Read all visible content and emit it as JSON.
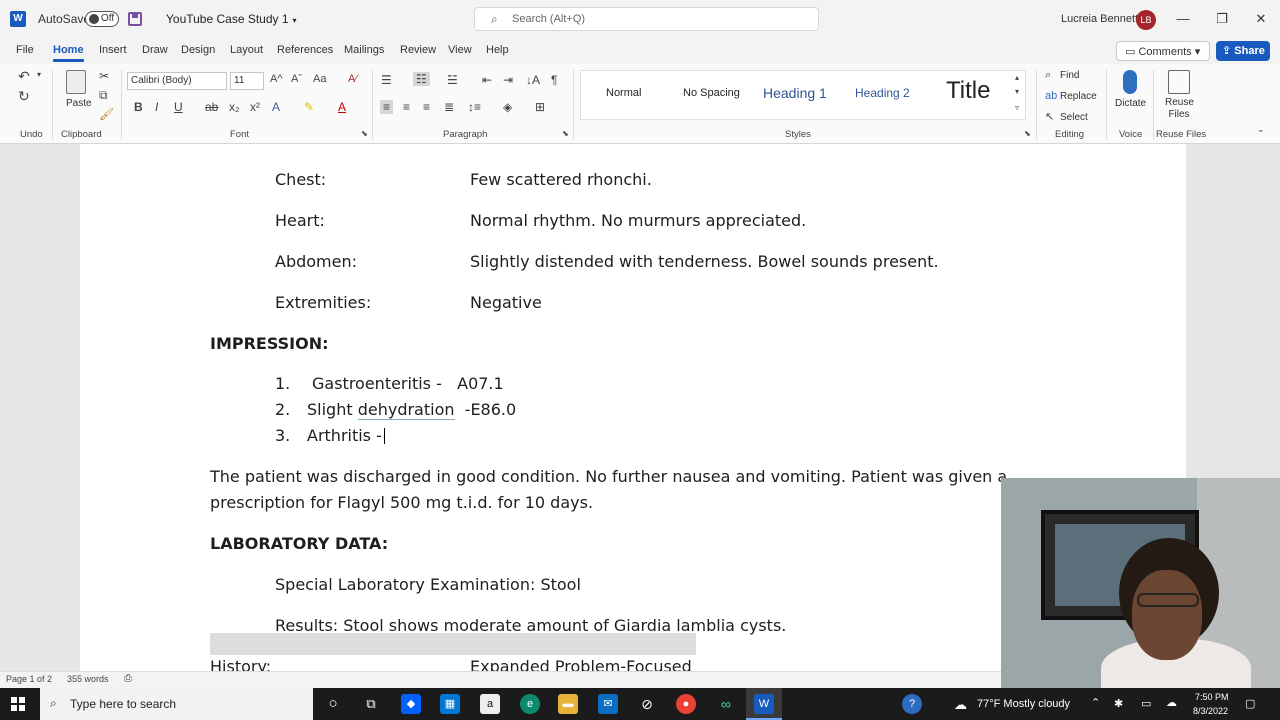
{
  "titlebar": {
    "app_icon": "word-icon",
    "autosave_label": "AutoSave",
    "autosave_state": "Off",
    "doc_title": "YouTube Case Study 1",
    "search_placeholder": "Search (Alt+Q)",
    "user_name": "Lucreia Bennett",
    "user_initials": "LB"
  },
  "tabs": [
    "File",
    "Home",
    "Insert",
    "Draw",
    "Design",
    "Layout",
    "References",
    "Mailings",
    "Review",
    "View",
    "Help"
  ],
  "active_tab": "Home",
  "comments_label": "Comments",
  "share_label": "Share",
  "ribbon": {
    "groups": {
      "undo": "Undo",
      "clipboard": "Clipboard",
      "font": "Font",
      "paragraph": "Paragraph",
      "styles": "Styles",
      "editing": "Editing",
      "voice": "Voice",
      "reuse": "Reuse Files"
    },
    "paste_label": "Paste",
    "font_name": "Calibri (Body)",
    "font_size": "11",
    "styles": [
      "Normal",
      "No Spacing",
      "Heading 1",
      "Heading 2",
      "Title"
    ],
    "find_label": "Find",
    "replace_label": "Replace",
    "select_label": "Select",
    "dictate_label": "Dictate",
    "reuse_files_label": "Reuse Files"
  },
  "document": {
    "exam_rows": [
      {
        "label": "Chest:",
        "value": "Few scattered rhonchi."
      },
      {
        "label": "Heart:",
        "value": "Normal rhythm.  No murmurs appreciated."
      },
      {
        "label": "Abdomen:",
        "value": "Slightly distended with tenderness.  Bowel sounds present."
      },
      {
        "label": "Extremities:",
        "value": "Negative"
      }
    ],
    "impression_heading": "IMPRESSION:",
    "impressions": [
      {
        "num": "1.",
        "text": "Gastroenteritis -   A07.1"
      },
      {
        "num": "2.",
        "text_a": "Slight ",
        "text_b": "dehydration",
        "text_c": "  -E86.0"
      },
      {
        "num": "3.",
        "text": "Arthritis -"
      }
    ],
    "discharge_line1": "The patient was discharged in good condition.  No further nausea and vomiting.  Patient was given a",
    "discharge_line2": "prescription for Flagyl 500 mg t.i.d. for 10 days.",
    "lab_heading": "LABORATORY DATA:",
    "lab_exam": "Special Laboratory Examination:  Stool",
    "lab_results": "Results:  Stool shows moderate amount of Giardia lamblia cysts.",
    "history_label": "History:",
    "history_value": "Expanded Problem-Focused"
  },
  "statusbar": {
    "page": "Page 1 of 2",
    "words": "355 words"
  },
  "taskbar": {
    "search_placeholder": "Type here to search",
    "weather": "77°F  Mostly cloudy",
    "time": "7:50 PM",
    "date": "8/3/2022"
  }
}
